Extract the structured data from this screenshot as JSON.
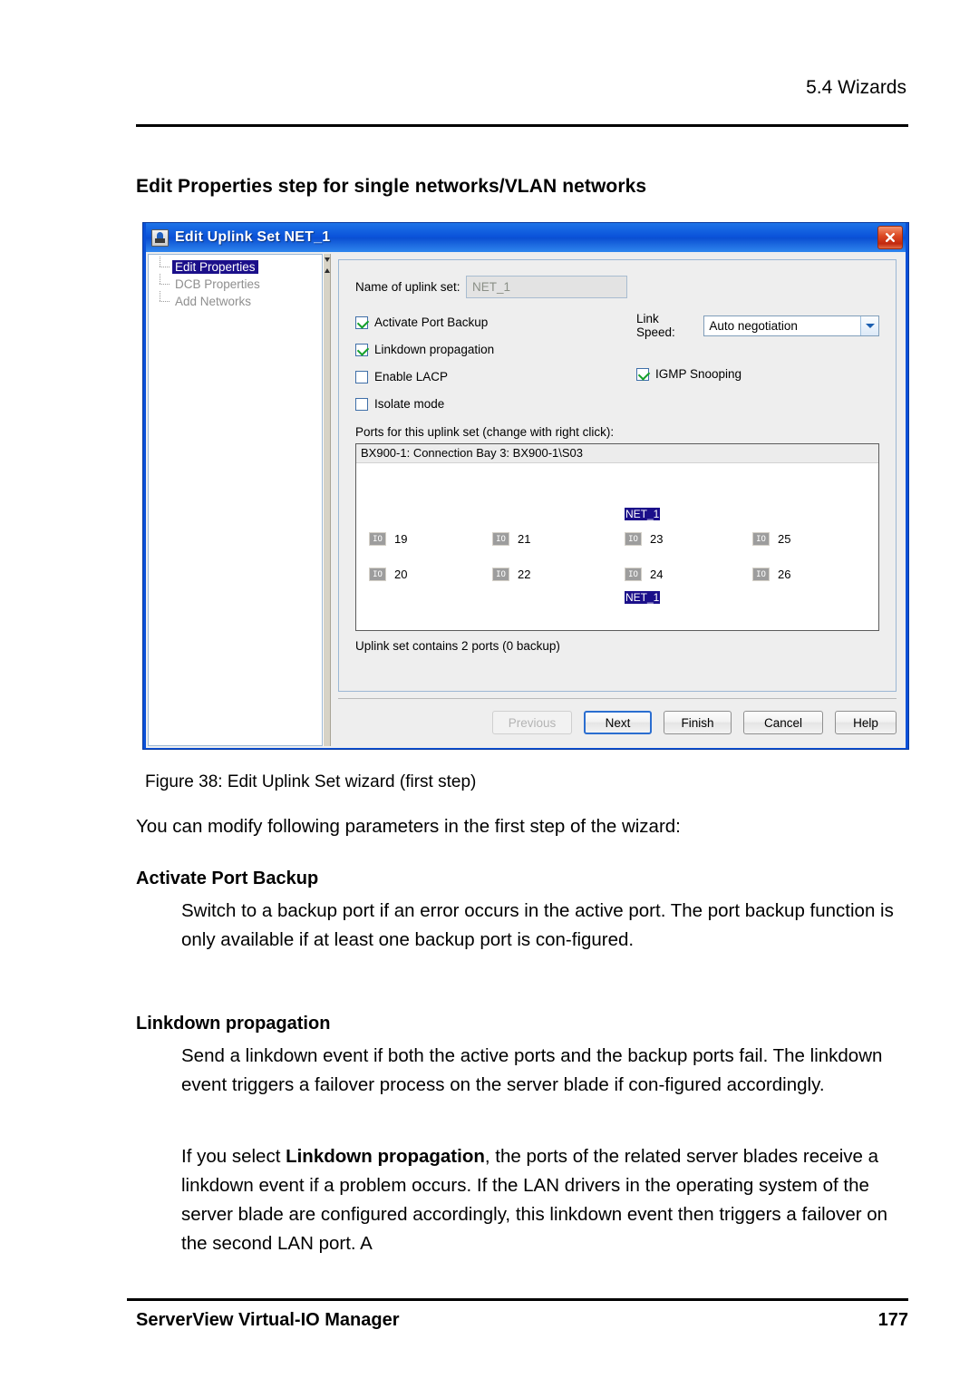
{
  "document": {
    "running_head": "5.4 Wizards",
    "section_title": "Edit Properties step for single networks/VLAN networks",
    "figure_caption": "Figure 38: Edit Uplink Set wizard (first step)",
    "intro_paragraph": "You can modify following parameters in the first step of the wizard:",
    "terms": [
      {
        "name": "Activate Port Backup",
        "body": "Switch to a backup port if an error occurs in the active port. The port backup function is only available if at least one backup port is con-figured."
      },
      {
        "name": "Linkdown propagation",
        "body": "Send a linkdown event if both the active ports and the backup ports fail. The linkdown event triggers a failover process on the server blade if con-figured accordingly.",
        "body2_prefix": "If you select ",
        "body2_bold": "Linkdown propagation",
        "body2_suffix": ", the ports of the related server blades receive a linkdown event if a problem occurs. If the LAN drivers in the operating system of the server blade are configured accordingly, this linkdown event then triggers a failover on the second LAN port. A"
      }
    ],
    "footer": {
      "product": "ServerView Virtual-IO Manager",
      "page_number": "177"
    }
  },
  "dialog": {
    "title": "Edit Uplink Set NET_1",
    "title_icon": "java-coffee-cup-icon",
    "close_icon": "close-icon",
    "titlebar_color": "#0a52d9",
    "close_color": "#c2280e",
    "tree": {
      "items": [
        {
          "label": "Edit Properties",
          "selected": true
        },
        {
          "label": "DCB Properties",
          "selected": false
        },
        {
          "label": "Add Networks",
          "selected": false
        }
      ],
      "selection_color": "#1b0f8a"
    },
    "splitter": {
      "collapse_left_icon": "triangle-up-icon",
      "collapse_right_icon": "triangle-down-icon"
    },
    "form": {
      "name_label": "Name of uplink set:",
      "name_value": "NET_1",
      "name_disabled": true,
      "checkboxes": [
        {
          "label": "Activate Port Backup",
          "checked": true
        },
        {
          "label": "Linkdown propagation",
          "checked": true
        },
        {
          "label": "Enable LACP",
          "checked": false
        },
        {
          "label": "Isolate mode",
          "checked": false
        }
      ],
      "link_speed_label": "Link Speed:",
      "link_speed_value": "Auto negotiation",
      "igmp": {
        "label": "IGMP Snooping",
        "checked": true
      },
      "check_color": "#15a02a"
    },
    "ports": {
      "caption": "Ports for this uplink set (change with right click):",
      "group_header": "BX900-1: Connection Bay 3: BX900-1\\S03",
      "columns": [
        {
          "top": {
            "number": "19",
            "icon": "io-port-icon",
            "tag": ""
          },
          "bottom": {
            "number": "20",
            "icon": "io-port-icon",
            "tag": ""
          }
        },
        {
          "top": {
            "number": "21",
            "icon": "io-port-icon",
            "tag": ""
          },
          "bottom": {
            "number": "22",
            "icon": "io-port-icon",
            "tag": ""
          }
        },
        {
          "top": {
            "number": "23",
            "icon": "io-port-icon",
            "tag": "NET_1"
          },
          "bottom": {
            "number": "24",
            "icon": "io-port-icon",
            "tag": "NET_1"
          }
        },
        {
          "top": {
            "number": "25",
            "icon": "io-port-icon",
            "tag": ""
          },
          "bottom": {
            "number": "26",
            "icon": "io-port-icon",
            "tag": ""
          }
        }
      ],
      "icon_glyph": "IO",
      "summary": "Uplink set contains 2 ports (0 backup)",
      "tag_color": "#1b0f8a"
    },
    "buttons": [
      {
        "label": "Previous",
        "state": "disabled"
      },
      {
        "label": "Next",
        "state": "default"
      },
      {
        "label": "Finish",
        "state": "normal"
      },
      {
        "label": "Cancel",
        "state": "normal"
      },
      {
        "label": "Help",
        "state": "normal"
      }
    ]
  }
}
